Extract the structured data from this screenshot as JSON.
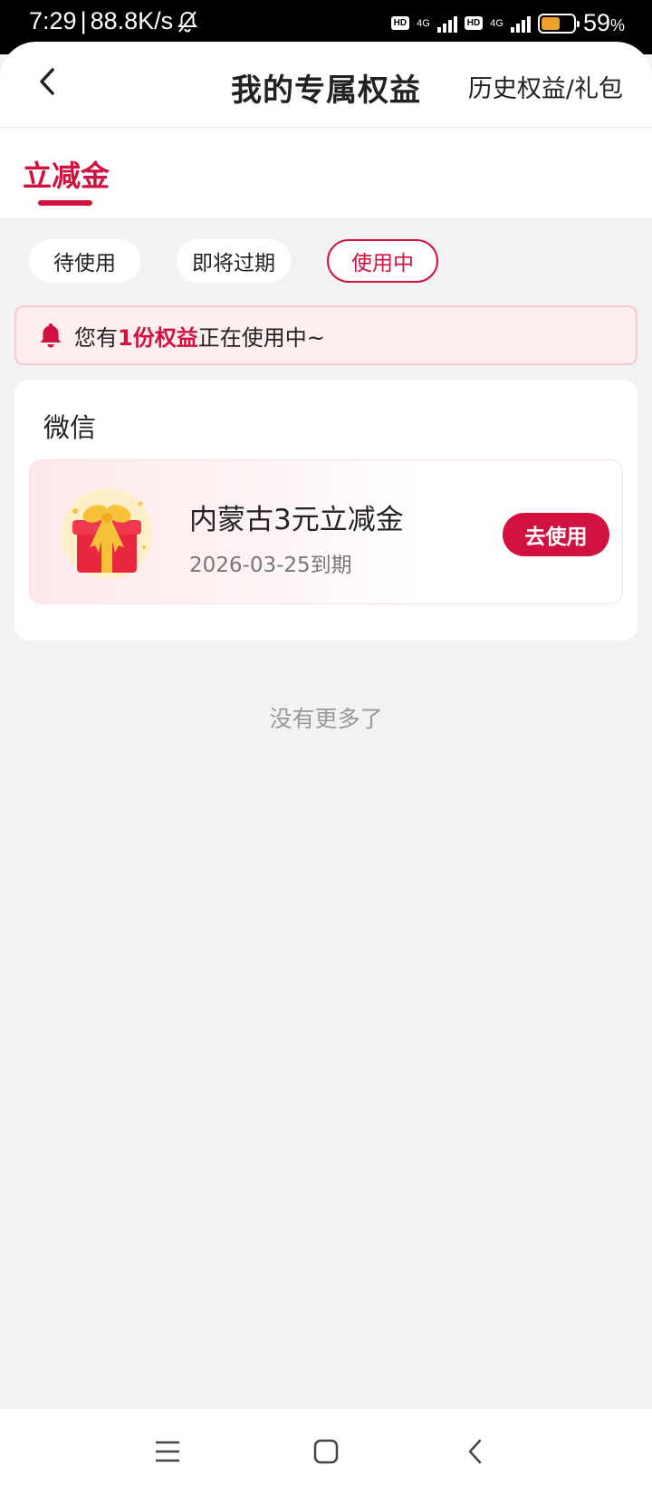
{
  "status_bar": {
    "time": "7:29",
    "speed": "88.8K/s",
    "net_type": "4G",
    "battery_percent": "59",
    "battery_unit": "%",
    "battery_level": 0.59,
    "battery_color": "#f0a028"
  },
  "header": {
    "title": "我的专属权益",
    "history_link": "历史权益/礼包",
    "back_icon": "chevron-left-icon"
  },
  "tabs": {
    "active_label": "立减金"
  },
  "filters": [
    {
      "label": "待使用",
      "selected": false
    },
    {
      "label": "即将过期",
      "selected": false
    },
    {
      "label": "使用中",
      "selected": true
    }
  ],
  "notice": {
    "prefix": "您有",
    "highlight": "1份权益",
    "suffix": "正在使用中~",
    "icon": "bell-icon"
  },
  "section": {
    "title": "微信",
    "vouchers": [
      {
        "name": "内蒙古3元立减金",
        "expiry": "2026-03-25到期",
        "button": "去使用",
        "icon": "gift-box-icon"
      }
    ]
  },
  "footer_text": "没有更多了",
  "nav_bar": {
    "menu_icon": "menu-icon",
    "home_icon": "home-square-icon",
    "back_icon": "back-chevron-icon"
  },
  "colors": {
    "accent": "#d1113f",
    "background": "#f2f2f2",
    "notice_bg": "#fdeeef"
  }
}
